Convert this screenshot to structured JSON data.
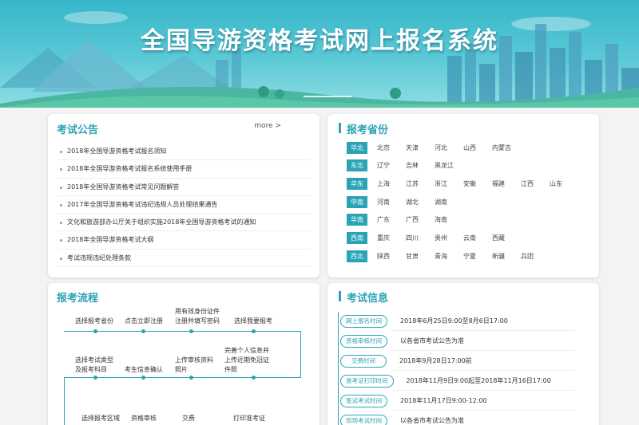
{
  "banner": {
    "title": "全国导游资格考试网上报名系统"
  },
  "notice": {
    "title": "考试公告",
    "more": "more >",
    "items": [
      "2018年全国导游资格考试报名须知",
      "2018年全国导游资格考试报名系统使用手册",
      "2018年全国导游资格考试常见问题解答",
      "2017年全国导游资格考试违纪违规人员处理结果通告",
      "文化和旅游部办公厅关于组织实施2018年全国导游资格考试的通知",
      "2018年全国导游资格考试大纲",
      "考试违规违纪处理条款"
    ]
  },
  "provinces": {
    "title": "报考省份",
    "rows": [
      {
        "region": "华北",
        "items": [
          "北京",
          "天津",
          "河北",
          "山西",
          "内蒙古"
        ]
      },
      {
        "region": "东北",
        "items": [
          "辽宁",
          "吉林",
          "黑龙江"
        ]
      },
      {
        "region": "华东",
        "items": [
          "上海",
          "江苏",
          "浙江",
          "安徽",
          "福建",
          "江西",
          "山东"
        ]
      },
      {
        "region": "中南",
        "items": [
          "河南",
          "湖北",
          "湖南"
        ]
      },
      {
        "region": "华南",
        "items": [
          "广东",
          "广西",
          "海南"
        ]
      },
      {
        "region": "西南",
        "items": [
          "重庆",
          "四川",
          "贵州",
          "云南",
          "西藏"
        ]
      },
      {
        "region": "西北",
        "items": [
          "陕西",
          "甘肃",
          "青海",
          "宁夏",
          "新疆",
          "兵团"
        ]
      }
    ]
  },
  "flow": {
    "title": "报考流程",
    "step1": "选择报考省份",
    "step2": "点击立即注册",
    "step3a": "用有效身份证件",
    "step3b": "注册并填写密码",
    "step4": "选择我要报考",
    "step5a": "选择考试类型",
    "step5b": "及报考科目",
    "step6": "考生信息确认",
    "step7a": "上传审核资料",
    "step7b": "照片",
    "step8a": "完善个人信息并",
    "step8b": "上传近期免冠证",
    "step8c": "件照",
    "step9": "选择报考区域",
    "step10": "资格审核",
    "step11": "交费",
    "step12": "打印准考证"
  },
  "info": {
    "title": "考试信息",
    "rows": [
      {
        "label": "网上报名时间",
        "value": "2018年6月25日9:00至8月6日17:00"
      },
      {
        "label": "资格审核时间",
        "value": "以各省市考试公告为准"
      },
      {
        "label": "交费时间",
        "value": "2018年9月28日17:00前"
      },
      {
        "label": "准考证打印时间",
        "value": "2018年11月9日9:00起至2018年11月16日17:00"
      },
      {
        "label": "笔试考试时间",
        "value": "2018年11月17日9:00-12:00"
      },
      {
        "label": "现场考试时间",
        "value": "以各省市考试公告为准"
      }
    ]
  },
  "colors": {
    "accent": "#2aa3b5",
    "banner_top": "#36b6c9",
    "background": "#f1f3f5"
  }
}
